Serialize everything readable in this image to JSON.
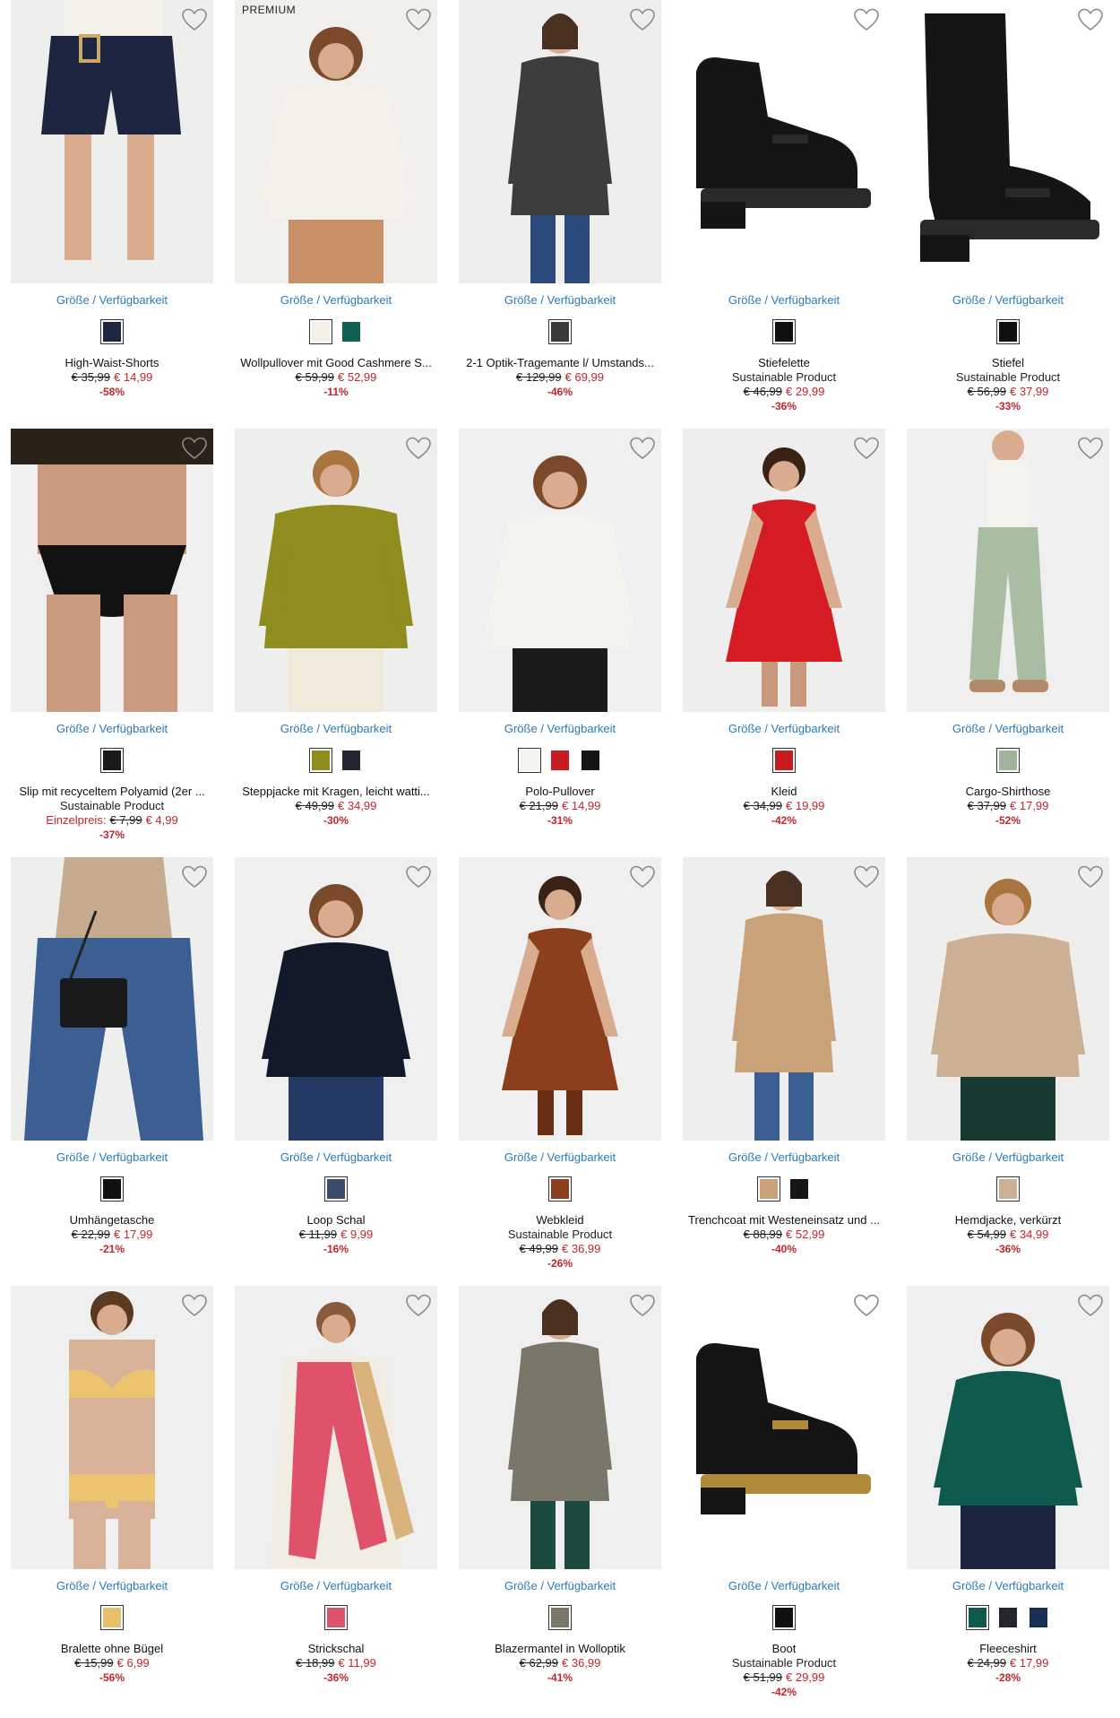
{
  "common": {
    "size_link": "Größe / Verfügbarkeit"
  },
  "products": [
    {
      "name": "High-Waist-Shorts",
      "old": "€ 35,99",
      "new": "€ 14,99",
      "discount": "-58%",
      "swatches": [
        "#1d2540"
      ],
      "bg": "#eeeeec",
      "fig": "shorts",
      "c1": "#1d2540",
      "c2": "#f4f1ea"
    },
    {
      "name": "Wollpullover mit Good Cashmere S...",
      "badge": "PREMIUM",
      "old": "€ 59,99",
      "new": "€ 52,99",
      "discount": "-11%",
      "swatches": [
        "#f2efe7",
        "#0f5f52"
      ],
      "bg": "#f1efec",
      "fig": "sweater",
      "c1": "#f4f1ea",
      "c2": "#c98f66"
    },
    {
      "name": "2-1 Optik-Tragemante l/ Umstands...",
      "old": "€ 129,99",
      "new": "€ 69,99",
      "discount": "-46%",
      "swatches": [
        "#3a3a3a"
      ],
      "bg": "#eeeeee",
      "fig": "coat",
      "c1": "#3d3d3f",
      "c2": "#2c4b7c"
    },
    {
      "name": "Stiefelette",
      "sub": "Sustainable Product",
      "old": "€ 46,99",
      "new": "€ 29,99",
      "discount": "-36%",
      "swatches": [
        "#111111"
      ],
      "bg": "#ffffff",
      "fig": "bootie",
      "c1": "#151515",
      "c2": "#2a2a2a"
    },
    {
      "name": "Stiefel",
      "sub": "Sustainable Product",
      "old": "€ 56,99",
      "new": "€ 37,99",
      "discount": "-33%",
      "swatches": [
        "#111111"
      ],
      "bg": "#ffffff",
      "fig": "boot",
      "c1": "#151515",
      "c2": "#2a2a2a"
    },
    {
      "name": "Slip mit recyceltem Polyamid (2er ...",
      "sub": "Sustainable Product",
      "label": "Einzelpreis:",
      "old": "€ 7,99",
      "new": "€ 4,99",
      "discount": "-37%",
      "swatches": [
        "#1a1a1a"
      ],
      "bg": "#efefef",
      "fig": "slip",
      "c1": "#121212",
      "c2": "#c99a7e"
    },
    {
      "name": "Steppjacke mit Kragen, leicht watti...",
      "old": "€ 49,99",
      "new": "€ 34,99",
      "discount": "-30%",
      "swatches": [
        "#8e8d1e",
        "#23262f"
      ],
      "bg": "#eeeeec",
      "fig": "jacket",
      "c1": "#8e8d1e",
      "c2": "#efe9da"
    },
    {
      "name": "Polo-Pullover",
      "old": "€ 21,99",
      "new": "€ 14,99",
      "discount": "-31%",
      "swatches": [
        "#f4f3ee",
        "#c81a22",
        "#151515"
      ],
      "bg": "#efefef",
      "fig": "sweater",
      "c1": "#f4f3ee",
      "c2": "#1b1b1b"
    },
    {
      "name": "Kleid",
      "old": "€ 34,99",
      "new": "€ 19,99",
      "discount": "-42%",
      "swatches": [
        "#c81a22"
      ],
      "bg": "#eeeeee",
      "fig": "dress",
      "c1": "#d51c24",
      "c2": "#c8987c"
    },
    {
      "name": "Cargo-Shirthose",
      "old": "€ 37,99",
      "new": "€ 17,99",
      "discount": "-52%",
      "swatches": [
        "#9fb49a"
      ],
      "bg": "#efefef",
      "fig": "pants",
      "c1": "#a8bda2",
      "c2": "#f4f3ee"
    },
    {
      "name": "Umhängetasche",
      "old": "€ 22,99",
      "new": "€ 17,99",
      "discount": "-21%",
      "swatches": [
        "#111111"
      ],
      "bg": "#eeeeec",
      "fig": "bag",
      "c1": "#1a1a1a",
      "c2": "#3b5f92"
    },
    {
      "name": "Loop Schal",
      "old": "€ 11,99",
      "new": "€ 9,99",
      "discount": "-16%",
      "swatches": [
        "#3b4d6b"
      ],
      "bg": "#efefef",
      "fig": "sweater",
      "c1": "#121a2a",
      "c2": "#263a66"
    },
    {
      "name": "Webkleid",
      "sub": "Sustainable Product",
      "old": "€ 49,99",
      "new": "€ 36,99",
      "discount": "-26%",
      "swatches": [
        "#8c3f1c"
      ],
      "bg": "#efefef",
      "fig": "dress",
      "c1": "#8c3f1c",
      "c2": "#6a2e14"
    },
    {
      "name": "Trenchcoat mit Westeneinsatz und ...",
      "old": "€ 88,99",
      "new": "€ 52,99",
      "discount": "-40%",
      "swatches": [
        "#c9a27a",
        "#151515"
      ],
      "bg": "#eeeeee",
      "fig": "coat",
      "c1": "#c9a27a",
      "c2": "#3b5f92"
    },
    {
      "name": "Hemdjacke, verkürzt",
      "old": "€ 54,99",
      "new": "€ 34,99",
      "discount": "-36%",
      "swatches": [
        "#cdb094"
      ],
      "bg": "#eeeeec",
      "fig": "jacket",
      "c1": "#cdb094",
      "c2": "#173a33"
    },
    {
      "name": "Bralette ohne Bügel",
      "old": "€ 15,99",
      "new": "€ 6,99",
      "discount": "-56%",
      "swatches": [
        "#e8c06c"
      ],
      "bg": "#efefef",
      "fig": "bra",
      "c1": "#ecc46f",
      "c2": "#d8b39a"
    },
    {
      "name": "Strickschal",
      "old": "€ 18,99",
      "new": "€ 11,99",
      "discount": "-36%",
      "swatches": [
        "#e0516a"
      ],
      "bg": "#efefef",
      "fig": "scarf",
      "c1": "#e0516a",
      "c2": "#d9b27c"
    },
    {
      "name": "Blazermantel in Wolloptik",
      "old": "€ 62,99",
      "new": "€ 36,99",
      "discount": "-41%",
      "swatches": [
        "#7a7669"
      ],
      "bg": "#efefef",
      "fig": "coat",
      "c1": "#7a7669",
      "c2": "#1d4a3f"
    },
    {
      "name": "Boot",
      "sub": "Sustainable Product",
      "old": "€ 51,99",
      "new": "€ 29,99",
      "discount": "-42%",
      "swatches": [
        "#111111"
      ],
      "bg": "#ffffff",
      "fig": "bootie",
      "c1": "#151515",
      "c2": "#b08a3a"
    },
    {
      "name": "Fleeceshirt",
      "old": "€ 24,99",
      "new": "€ 17,99",
      "discount": "-28%",
      "swatches": [
        "#0f5a4e",
        "#23262f",
        "#1a2f56"
      ],
      "bg": "#efefef",
      "fig": "sweater",
      "c1": "#0f5a4e",
      "c2": "#1c2440"
    }
  ]
}
